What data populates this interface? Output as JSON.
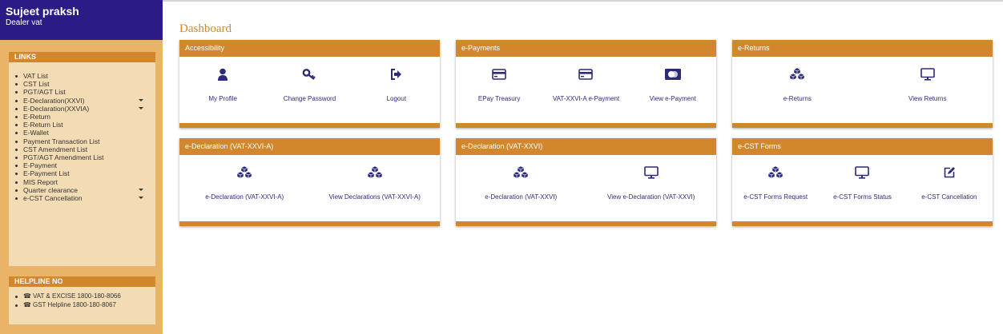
{
  "user": {
    "name": "Sujeet praksh",
    "role": "Dealer vat"
  },
  "links": {
    "title": "LINKS",
    "items": [
      {
        "label": "VAT List",
        "has_submenu": false
      },
      {
        "label": "CST List",
        "has_submenu": false
      },
      {
        "label": "PGT/AGT List",
        "has_submenu": false
      },
      {
        "label": "E-Declaration(XXVI)",
        "has_submenu": true
      },
      {
        "label": "E-Declaration(XXVIA)",
        "has_submenu": true
      },
      {
        "label": "E-Return",
        "has_submenu": false
      },
      {
        "label": "E-Return List",
        "has_submenu": false
      },
      {
        "label": "E-Wallet",
        "has_submenu": false
      },
      {
        "label": "Payment Transaction List",
        "has_submenu": false
      },
      {
        "label": "CST Amendment List",
        "has_submenu": false
      },
      {
        "label": "PGT/AGT Amendment List",
        "has_submenu": false
      },
      {
        "label": "E-Payment",
        "has_submenu": false
      },
      {
        "label": "E-Payment List",
        "has_submenu": false
      },
      {
        "label": "MIS Report",
        "has_submenu": false
      },
      {
        "label": "Quarter clearance",
        "has_submenu": true
      },
      {
        "label": "e-CST Cancellation",
        "has_submenu": true
      }
    ]
  },
  "helpline": {
    "title": "HELPLINE NO",
    "items": [
      {
        "label": "VAT & EXCISE 1800-180-8066"
      },
      {
        "label": "GST Helpline 1800-180-8067"
      }
    ]
  },
  "main": {
    "title": "Dashboard",
    "cards": [
      {
        "title": "Accessibility",
        "items": [
          {
            "label": "My Profile",
            "icon": "user-icon"
          },
          {
            "label": "Change Password",
            "icon": "key-icon"
          },
          {
            "label": "Logout",
            "icon": "logout-icon"
          }
        ]
      },
      {
        "title": "e-Payments",
        "items": [
          {
            "label": "EPay Treasury",
            "icon": "credit-card-icon"
          },
          {
            "label": "VAT-XXVI-A e-Payment",
            "icon": "credit-card-icon"
          },
          {
            "label": "View e-Payment",
            "icon": "mastercard-icon"
          }
        ]
      },
      {
        "title": "e-Returns",
        "items": [
          {
            "label": "e-Returns",
            "icon": "cubes-icon"
          },
          {
            "label": "View Returns",
            "icon": "monitor-icon"
          }
        ]
      },
      {
        "title": "e-Declaration (VAT-XXVI-A)",
        "items": [
          {
            "label": "e-Declaration (VAT-XXVI-A)",
            "icon": "cubes-icon"
          },
          {
            "label": "View Declarations (VAT-XXVI-A)",
            "icon": "cubes-icon"
          }
        ]
      },
      {
        "title": "e-Declaration (VAT-XXVI)",
        "items": [
          {
            "label": "e-Declaration (VAT-XXVI)",
            "icon": "cubes-icon"
          },
          {
            "label": "View e-Declaration (VAT-XXVI)",
            "icon": "monitor-icon"
          }
        ]
      },
      {
        "title": "e-CST Forms",
        "items": [
          {
            "label": "e-CST Forms Request",
            "icon": "cubes-icon"
          },
          {
            "label": "e-CST Forms Status",
            "icon": "monitor-icon"
          },
          {
            "label": "e-CST Cancellation",
            "icon": "edit-icon"
          }
        ]
      }
    ]
  },
  "colors": {
    "accent": "#d3872c",
    "sidebar": "#e9b468",
    "header": "#2b1b86",
    "icon": "#2b2b7a"
  }
}
